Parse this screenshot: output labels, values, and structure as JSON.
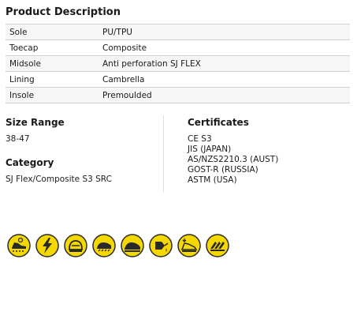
{
  "product": {
    "title": "Product Description",
    "specs": [
      {
        "label": "Sole",
        "value": "PU/TPU"
      },
      {
        "label": "Toecap",
        "value": "Composite"
      },
      {
        "label": "Midsole",
        "value": "Anti perforation SJ FLEX"
      },
      {
        "label": "Lining",
        "value": "Cambrella"
      },
      {
        "label": "Insole",
        "value": "Premoulded"
      }
    ]
  },
  "size_range": {
    "heading": "Size Range",
    "value": "38-47"
  },
  "category": {
    "heading": "Category",
    "value": "SJ Flex/Composite S3 SRC"
  },
  "certificates": {
    "heading": "Certificates",
    "items": [
      "CE S3",
      "JIS (JAPAN)",
      "AS/NZS2210.3 (AUST)",
      "GOST-R (RUSSIA)",
      "ASTM (USA)"
    ]
  },
  "feature_icons": [
    "anti-slip-icon",
    "electrical-hazard-icon",
    "steel-toe-icon",
    "anti-perforation-icon",
    "safety-toe-cap-icon",
    "oil-resistant-icon",
    "heel-energy-absorption-icon",
    "slip-resistant-icon"
  ],
  "colors": {
    "icon_fill": "#f5d800",
    "icon_stroke": "#2a2a2a",
    "divider": "#cfcfcf",
    "row_alt": "#f6f6f6"
  }
}
